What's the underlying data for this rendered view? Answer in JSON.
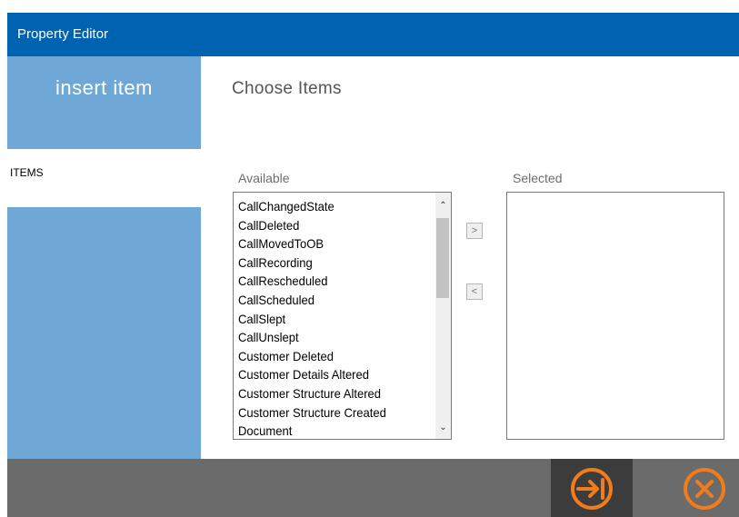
{
  "window": {
    "title": "Property Editor"
  },
  "sidebar": {
    "heading": "insert item",
    "items": [
      {
        "label": "ITEMS",
        "selected": true
      }
    ]
  },
  "main": {
    "section_title": "Choose Items",
    "available": {
      "label": "Available",
      "items": [
        "CallChangedState",
        "CallDeleted",
        "CallMovedToOB",
        "CallRecording",
        "CallRescheduled",
        "CallScheduled",
        "CallSlept",
        "CallUnslept",
        "Customer Deleted",
        "Customer Details Altered",
        "Customer Structure Altered",
        "Customer Structure Created",
        "Document"
      ]
    },
    "selected": {
      "label": "Selected",
      "items": []
    },
    "add_button": ">",
    "remove_button": "<"
  },
  "footer": {
    "apply_icon": "arrow-to-bar-icon",
    "cancel_icon": "close-circle-icon"
  },
  "colors": {
    "titlebar": "#0063b1",
    "sidebar": "#6fa8d6",
    "footer": "#6b6b6b",
    "accent": "#f07c1b"
  }
}
